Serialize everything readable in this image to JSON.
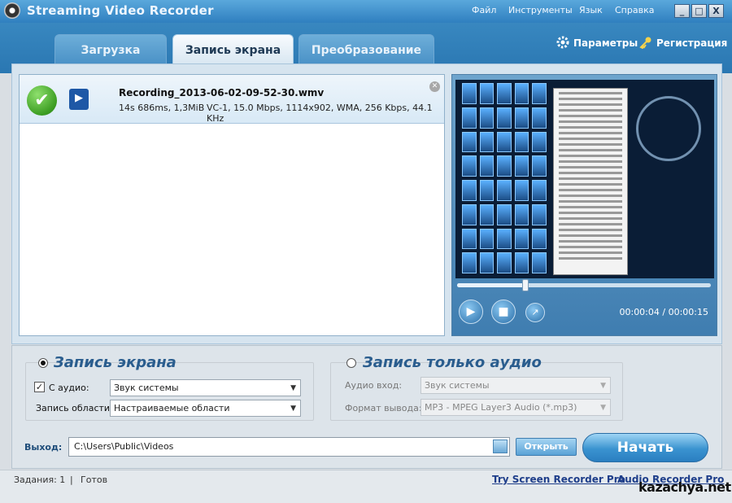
{
  "app": {
    "title": "Streaming Video Recorder"
  },
  "menu": [
    "Файл",
    "Инструменты",
    "Язык",
    "Справка"
  ],
  "window_buttons": [
    "_",
    "□",
    "X"
  ],
  "tabs": [
    {
      "label": "Загрузка"
    },
    {
      "label": "Запись экрана"
    },
    {
      "label": "Преобразование"
    }
  ],
  "top_links": {
    "settings": "Параметры",
    "register": "Регистрация"
  },
  "recording": {
    "filename": "Recording_2013-06-02-09-52-30.wmv",
    "duration_size": "14s 686ms, 1,3MiB",
    "details": "VC-1, 15.0 Mbps, 1114x902, WMA, 256 Kbps, 44.1 KHz"
  },
  "player": {
    "time": "00:00:04 / 00:00:15",
    "progress": 0.27
  },
  "screen_group": {
    "title": "Запись экрана",
    "audio_label": "С аудио:",
    "audio_value": "Звук системы",
    "area_label": "Запись области:",
    "area_value": "Настраиваемые области"
  },
  "audio_group": {
    "title": "Запись только аудио",
    "input_label": "Аудио вход:",
    "input_value": "Звук системы",
    "format_label": "Формат вывода:",
    "format_value": "MP3 - MPEG Layer3 Audio (*.mp3)"
  },
  "output": {
    "label": "Выход:",
    "path": "C:\\Users\\Public\\Videos",
    "open_label": "Открыть",
    "start_label": "Начать"
  },
  "status": {
    "tasks": "Задания: 1",
    "state": "Готов",
    "promo1": "Try Screen Recorder Pro",
    "promo2": "Audio Recorder Pro",
    "watermark": "kazachya.net"
  }
}
